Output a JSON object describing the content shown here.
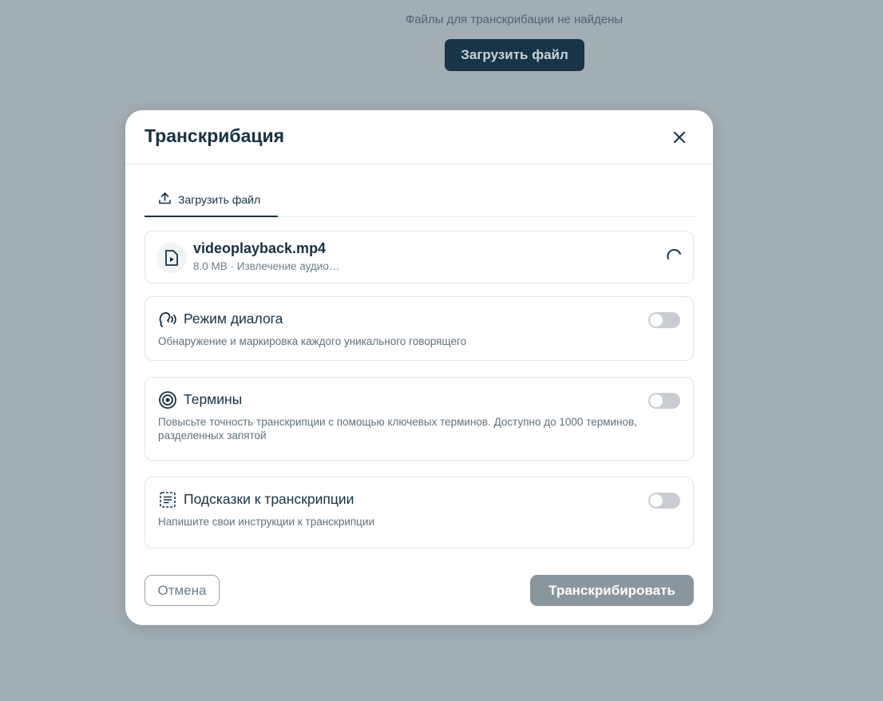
{
  "background": {
    "empty_message": "Файлы для транскрибации не найдены",
    "upload_button_label": "Загрузить файл"
  },
  "modal": {
    "title": "Транскрибация",
    "close_icon": "close-icon",
    "tab": {
      "label": "Загрузить файл",
      "icon": "upload-icon"
    },
    "file": {
      "name": "videoplayback.mp4",
      "meta": "8.0 MB · Извлечение аудио…",
      "icon": "video-file-icon",
      "status_icon": "spinner-icon"
    },
    "options": [
      {
        "title": "Режим диалога",
        "description": "Обнаружение и маркировка каждого уникального говорящего",
        "icon": "speaker-voice-icon",
        "enabled": false
      },
      {
        "title": "Термины",
        "description": "Повысьте точность транскрипции с помощью ключевых терминов. Доступно до 1000 терминов, разделенных запятой",
        "icon": "target-icon",
        "enabled": false
      },
      {
        "title": "Подсказки к транскрипции",
        "description": "Напишите свои инструкции к транскрипции",
        "icon": "prompt-list-icon",
        "enabled": false
      }
    ],
    "cancel_label": "Отмена",
    "submit_label": "Транскрибировать"
  },
  "colors": {
    "overlay_background": "#a3adb4",
    "primary_dark": "#183446",
    "disabled_button": "#8a969e",
    "toggle_off": "#c9cdd1"
  }
}
